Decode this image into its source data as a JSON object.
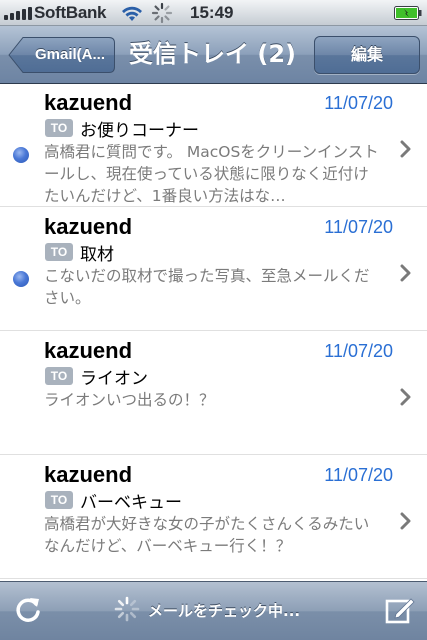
{
  "status_bar": {
    "carrier": "SoftBank",
    "time": "15:49",
    "icons": [
      "signal-bars-icon",
      "wifi-icon",
      "activity-spinner-icon",
      "battery-icon"
    ]
  },
  "nav": {
    "back_label": "Gmail(A...",
    "title": "受信トレイ (2)",
    "edit_label": "編集"
  },
  "messages": [
    {
      "sender": "kazuend",
      "date": "11/07/20",
      "badge": "TO",
      "subject": "お便りコーナー",
      "preview": "高橋君に質問です。 MacOSをクリーンインストールし、現在使っている状態に限りなく近付けたいんだけど、1番良い方法はな…",
      "unread": true
    },
    {
      "sender": "kazuend",
      "date": "11/07/20",
      "badge": "TO",
      "subject": "取材",
      "preview": "こないだの取材で撮った写真、至急メールください。",
      "unread": true
    },
    {
      "sender": "kazuend",
      "date": "11/07/20",
      "badge": "TO",
      "subject": "ライオン",
      "preview": "ライオンいつ出るの！？",
      "unread": false
    },
    {
      "sender": "kazuend",
      "date": "11/07/20",
      "badge": "TO",
      "subject": "バーベキュー",
      "preview": "高橋君が大好きな女の子がたくさんくるみたいなんだけど、バーベキュー行く！？",
      "unread": false
    }
  ],
  "toolbar": {
    "status_text": "メールをチェック中...",
    "icons": [
      "refresh-icon",
      "loading-spinner-icon",
      "compose-icon"
    ]
  },
  "colors": {
    "date_blue": "#2a6fd4",
    "unread_dot": "#4a78d6",
    "nav_bar": "#7a8fab",
    "preview_gray": "#7b7b7b"
  }
}
